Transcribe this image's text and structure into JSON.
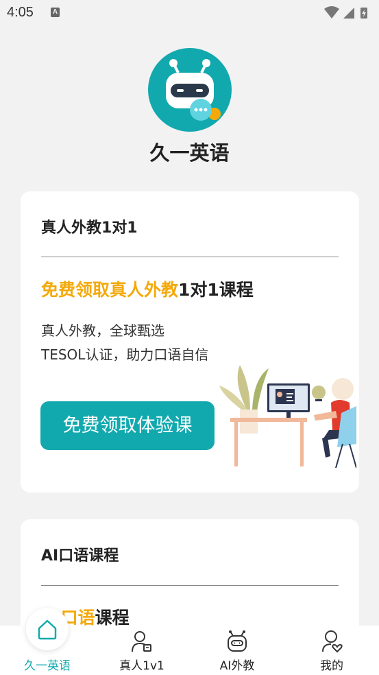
{
  "status_bar": {
    "time": "4:05",
    "notification_icon": "A"
  },
  "app": {
    "name": "久一英语",
    "accent_color": "#12a9ae",
    "highlight_color": "#f4a90a"
  },
  "card_1v1": {
    "title": "真人外教1对1",
    "headline_highlight": "免费领取真人外教",
    "headline_rest": "1对1课程",
    "desc_line1": "真人外教，全球甄选",
    "desc_line2": "TESOL认证，助力口语自信",
    "cta_label": "免费领取体验课"
  },
  "card_ai": {
    "title": "AI口语课程",
    "headline_highlight": "AI口语",
    "headline_rest": "课程"
  },
  "tabbar": {
    "tabs": [
      {
        "label": "久一英语",
        "icon": "home-icon",
        "active": true
      },
      {
        "label": "真人1v1",
        "icon": "teacher-icon",
        "active": false
      },
      {
        "label": "AI外教",
        "icon": "robot-icon",
        "active": false
      },
      {
        "label": "我的",
        "icon": "profile-icon",
        "active": false
      }
    ]
  }
}
